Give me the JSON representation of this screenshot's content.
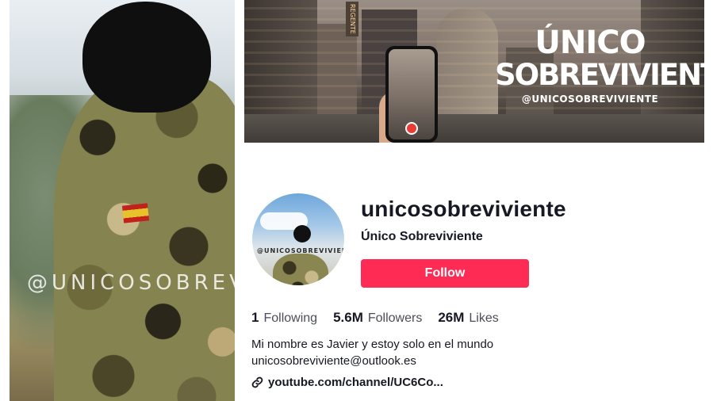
{
  "left_photo": {
    "watermark": "@UNICOSOBREVIVIENTE"
  },
  "banner": {
    "brand_line1": "ÚNICO",
    "brand_line2": "SOBREVIVIENTE",
    "handle": "@UNICOSOBREVIVIENTE",
    "sign_text": "REGENTE"
  },
  "profile": {
    "avatar_watermark": "@UNICOSOBREVIVIENTE",
    "username": "unicosobreviviente",
    "display_name": "Único Sobreviviente",
    "follow_label": "Follow",
    "stats": [
      {
        "value": "1",
        "label": "Following"
      },
      {
        "value": "5.6M",
        "label": "Followers"
      },
      {
        "value": "26M",
        "label": "Likes"
      }
    ],
    "bio_line1": "Mi nombre es Javier y estoy solo en el mundo",
    "bio_line2": "unicosobreviviente@outlook.es",
    "link_text": "youtube.com/channel/UC6Co...",
    "link_icon": "link-icon"
  },
  "colors": {
    "accent": "#fe2c55",
    "text_primary": "#161823",
    "text_secondary": "#4b4d57"
  }
}
